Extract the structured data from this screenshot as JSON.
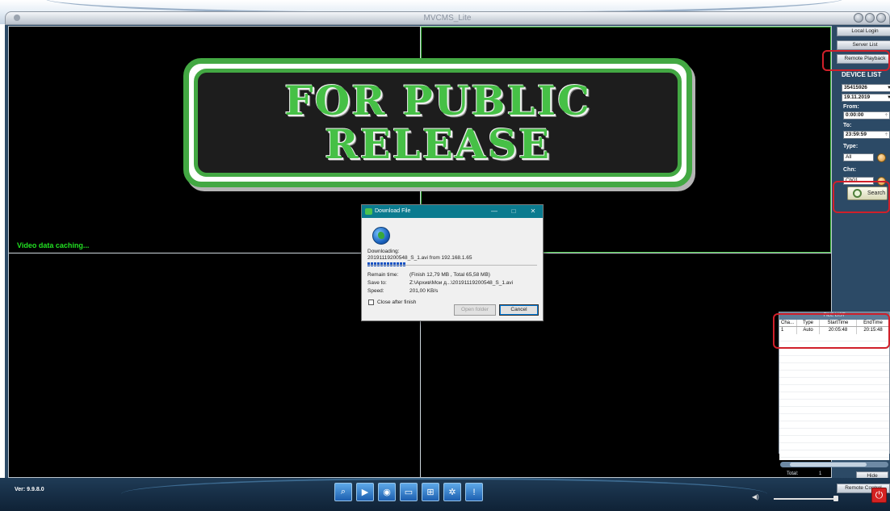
{
  "window": {
    "title": "MVCMS_Lite"
  },
  "video": {
    "caching_text": "Video data caching..."
  },
  "stamp": {
    "line1": "FOR PUBLIC",
    "line2": "RELEASE"
  },
  "dialog": {
    "title": "Download File",
    "minimize": "—",
    "maximize": "□",
    "close": "✕",
    "downloading_label": "Downloading:",
    "file_line": "20191119200548_S_1.avi  from  192.168.1.65",
    "remain_label": "Remain time:",
    "remain_value": "(Finish 12,79  MB , Total 65,58  MB)",
    "save_label": "Save to:",
    "save_value": "Z:\\Архив\\Мои д...\\20191119200548_S_1.avi",
    "speed_label": "Speed:",
    "speed_value": "201,00  KB/s",
    "close_after_label": "Close after finish",
    "open_folder": "Open folder",
    "cancel": "Cancel"
  },
  "right_panel": {
    "local_login": "Local Login",
    "server_list": "Server List",
    "remote_playback": "Remote Playback",
    "device_list_heading": "DEVICE LIST",
    "device": "35415926",
    "date": "19.11.2019",
    "from_label": "From:",
    "from_value": "0:00:00",
    "to_label": "To:",
    "to_value": "23:59:59",
    "type_label": "Type:",
    "type_value": "All",
    "chn_label": "Chn:",
    "chn_value": "Ch01",
    "search": "Search"
  },
  "file_list": {
    "title": "FILE LIST",
    "columns": [
      "Cha...",
      "Type",
      "StartTime",
      "EndTime"
    ],
    "rows": [
      {
        "channel": "1",
        "type": "Auto",
        "start": "20:05:48",
        "end": "20:15:48"
      }
    ],
    "total_label": "Total:",
    "total_value": "1",
    "hide": "Hide"
  },
  "remote_control": "Remote Control",
  "version": "Ver: 9.9.8.0",
  "toolbar_icons": [
    "search-icon",
    "playback-icon",
    "camera-icon",
    "monitor-icon",
    "network-icon",
    "settings-icon",
    "info-icon"
  ],
  "colors": {
    "stamp_green": "#43a843",
    "caching_green": "#22e022",
    "highlight_red": "#d0202a",
    "dialog_titlebar": "#0b7b8f",
    "panel_blue": "#2c4a66"
  }
}
